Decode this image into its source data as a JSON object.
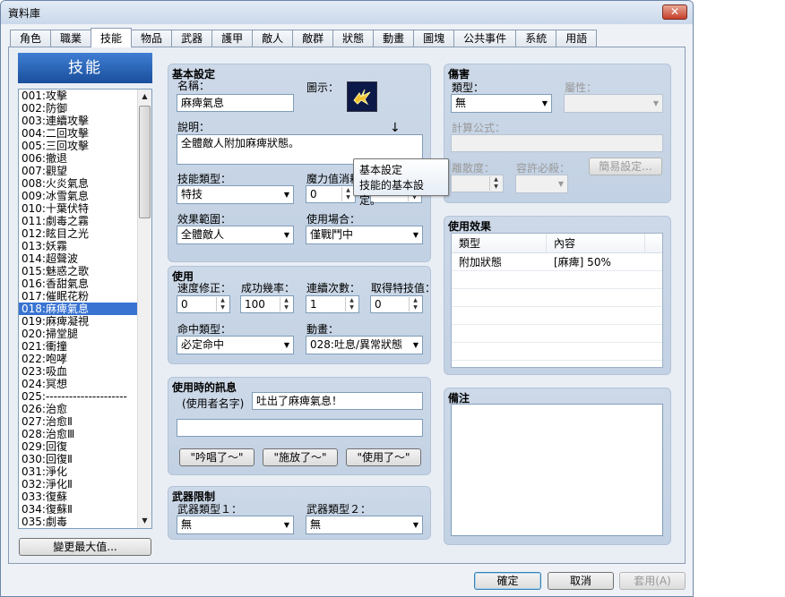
{
  "window": {
    "title": "資料庫",
    "close_label": "✕"
  },
  "tabs": [
    "角色",
    "職業",
    "技能",
    "物品",
    "武器",
    "護甲",
    "敵人",
    "敵群",
    "狀態",
    "動畫",
    "圖塊",
    "公共事件",
    "系統",
    "用語"
  ],
  "active_tab": 2,
  "left": {
    "header": "技能",
    "items": [
      "001:攻擊",
      "002:防御",
      "003:連續攻擊",
      "004:二回攻擊",
      "005:三回攻擊",
      "006:撤退",
      "007:觀望",
      "008:火炎氣息",
      "009:冰雪氣息",
      "010:十葉伏特",
      "011:劇毒之霧",
      "012:眩目之光",
      "013:妖霧",
      "014:超聲波",
      "015:魅惑之歌",
      "016:香甜氣息",
      "017:催眠花粉",
      "018:麻痺氣息",
      "019:麻痺凝視",
      "020:掃堂腿",
      "021:衝撞",
      "022:咆哮",
      "023:吸血",
      "024:冥想",
      "025:---------------------",
      "026:治愈",
      "027:治愈Ⅱ",
      "028:治愈Ⅲ",
      "029:回復",
      "030:回復Ⅱ",
      "031:淨化",
      "032:淨化Ⅱ",
      "033:復蘇",
      "034:復蘇Ⅱ",
      "035:劇毒"
    ],
    "selected_index": 17,
    "change_max_button": "變更最大值..."
  },
  "basic": {
    "title": "基本設定",
    "name_label": "名稱：",
    "name_value": "麻痺氣息",
    "icon_label": "圖示：",
    "desc_label": "說明：",
    "desc_value": "全體敵人附加麻痺狀態。",
    "skill_type_label": "技能類型：",
    "skill_type_value": "特技",
    "mp_cost_label": "魔力值消耗",
    "mp_cost_value": "0",
    "scope_label": "效果範圍：",
    "scope_value": "全體敵人",
    "occasion_label": "使用場合：",
    "occasion_value": "僅戰鬥中"
  },
  "tooltip": {
    "title": "基本設定",
    "text": "技能的基本設定。"
  },
  "use": {
    "title": "使用",
    "speed_label": "速度修正：",
    "speed_value": "0",
    "success_label": "成功幾率：",
    "success_value": "100",
    "repeat_label": "連續次數：",
    "repeat_value": "1",
    "tp_label": "取得特技值：",
    "tp_value": "0",
    "hit_type_label": "命中類型：",
    "hit_type_value": "必定命中",
    "animation_label": "動畫：",
    "animation_value": "028:吐息/異常狀態"
  },
  "message": {
    "title": "使用時的訊息",
    "user_name_label": "(使用者名字)",
    "line1": "吐出了麻痺氣息！",
    "line2": "",
    "btn_chant": "\"吟唱了～\"",
    "btn_cast": "\"施放了～\"",
    "btn_use": "\"使用了～\""
  },
  "weapon": {
    "title": "武器限制",
    "type1_label": "武器類型１：",
    "type1_value": "無",
    "type2_label": "武器類型２：",
    "type2_value": "無"
  },
  "damage": {
    "title": "傷害",
    "type_label": "類型：",
    "type_value": "無",
    "element_label": "屬性：",
    "formula_label": "計算公式：",
    "variance_label": "離散度：",
    "critical_label": "容許必殺：",
    "simple_button": "簡易設定..."
  },
  "effects": {
    "title": "使用效果",
    "columns": [
      "類型",
      "內容"
    ],
    "rows": [
      [
        "附加狀態",
        "[麻痺] 50%"
      ]
    ]
  },
  "note": {
    "title": "備注"
  },
  "footer": {
    "ok": "確定",
    "cancel": "取消",
    "apply": "套用(A)"
  }
}
